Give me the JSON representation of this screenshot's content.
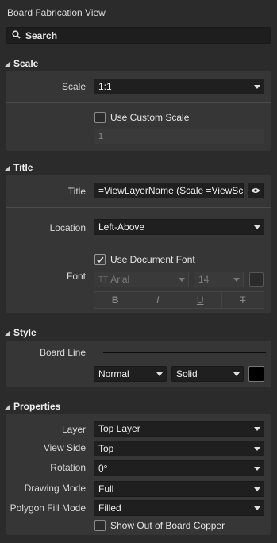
{
  "panel": {
    "title": "Board Fabrication View"
  },
  "search": {
    "placeholder": "Search"
  },
  "scale": {
    "header": "Scale",
    "label": "Scale",
    "value": "1:1",
    "custom_label": "Use Custom Scale",
    "custom_checked": false,
    "custom_value": "1"
  },
  "title": {
    "header": "Title",
    "label": "Title",
    "value": "=ViewLayerName (Scale =ViewScale)",
    "location_label": "Location",
    "location_value": "Left-Above",
    "font_label": "Font",
    "use_doc_font_label": "Use Document Font",
    "use_doc_font_checked": true,
    "font_name": "Arial",
    "font_size": "14",
    "format_buttons": [
      "B",
      "I",
      "U",
      "T"
    ]
  },
  "style": {
    "header": "Style",
    "board_line_label": "Board Line",
    "weight_value": "Normal",
    "line_style_value": "Solid",
    "line_color": "#000000"
  },
  "properties": {
    "header": "Properties",
    "layer_label": "Layer",
    "layer_value": "Top Layer",
    "view_side_label": "View Side",
    "view_side_value": "Top",
    "rotation_label": "Rotation",
    "rotation_value": "0°",
    "drawing_mode_label": "Drawing Mode",
    "drawing_mode_value": "Full",
    "polygon_fill_label": "Polygon Fill Mode",
    "polygon_fill_value": "Filled",
    "show_copper_label": "Show Out of Board Copper",
    "show_copper_checked": false
  },
  "icons": {
    "search": "search-icon",
    "eye": "eye-icon",
    "expand": "expand-triangle-icon"
  }
}
